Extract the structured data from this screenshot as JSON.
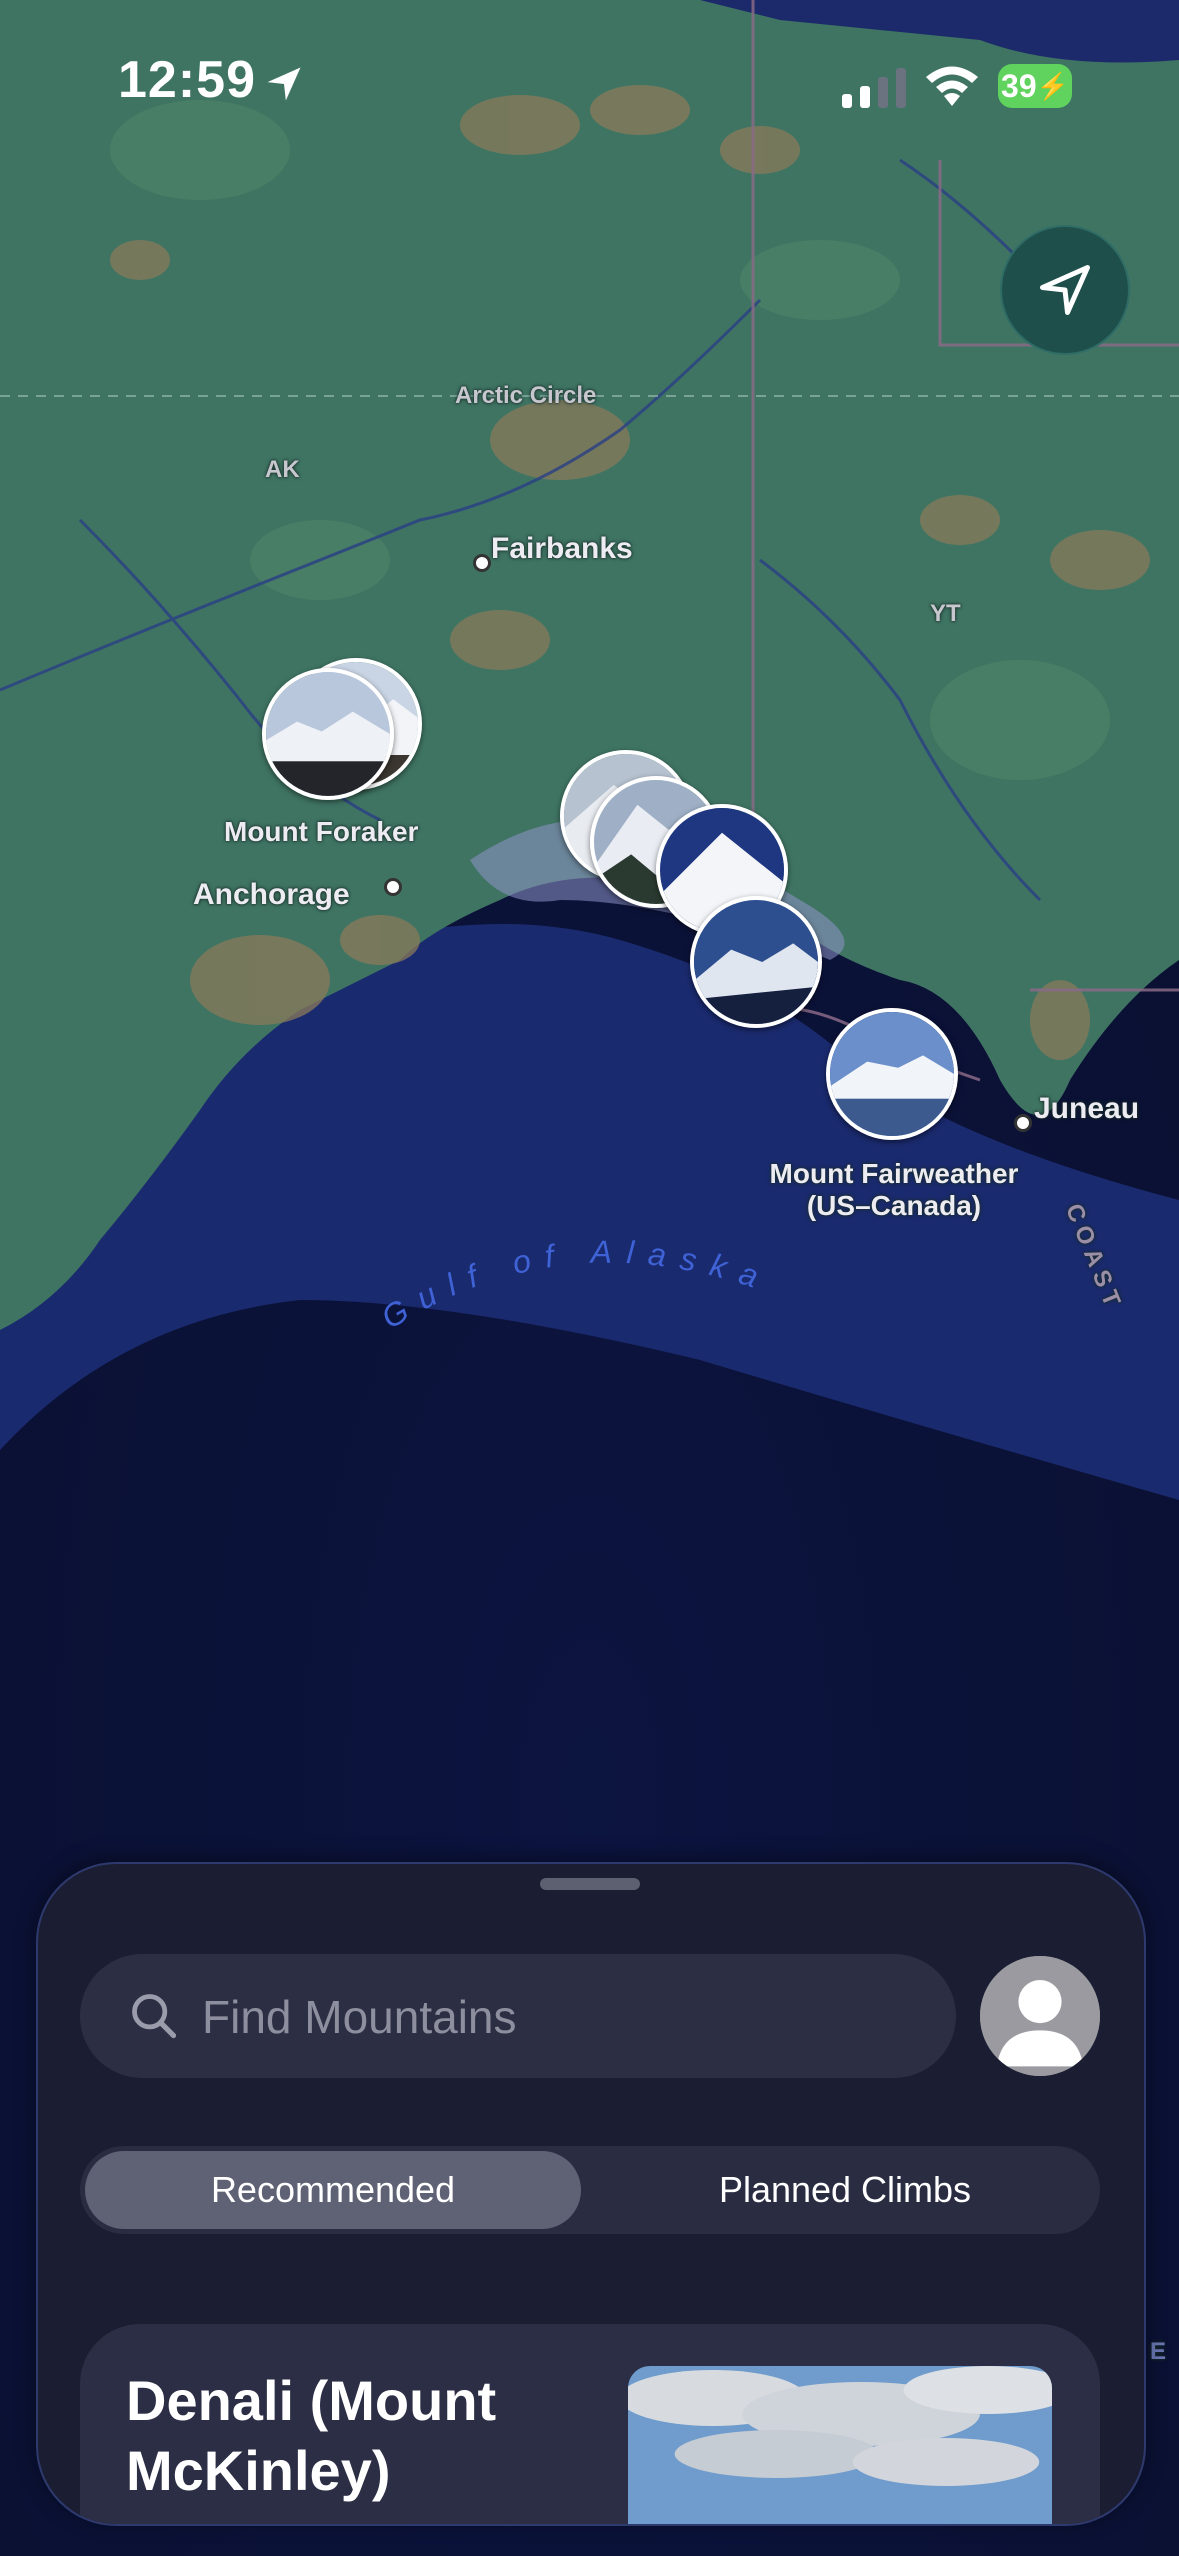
{
  "status_bar": {
    "time": "12:59",
    "battery_level": "39",
    "icons": [
      "location-arrow-icon",
      "cellular-signal-icon",
      "wifi-icon",
      "battery-charging-icon"
    ]
  },
  "map": {
    "labels": {
      "arctic_circle": "Arctic Circle",
      "ak": "AK",
      "fairbanks": "Fairbanks",
      "yt": "YT",
      "mount_foraker": "Mount Foraker",
      "anchorage": "Anchorage",
      "juneau": "Juneau",
      "mount_fairweather_line1": "Mount Fairweather",
      "mount_fairweather_line2": "(US–Canada)",
      "gulf_of_alaska": "Gulf of Alaska",
      "coast": "COAST",
      "edge_letter": "E"
    },
    "colors": {
      "land": "#3f7463",
      "water": "#1c2a6b",
      "deep_water": "#0b1236"
    }
  },
  "sheet": {
    "search_placeholder": "Find Mountains",
    "tabs": [
      {
        "label": "Recommended",
        "active": true
      },
      {
        "label": "Planned Climbs",
        "active": false
      }
    ],
    "card": {
      "title": "Denali (Mount McKinley)"
    }
  }
}
